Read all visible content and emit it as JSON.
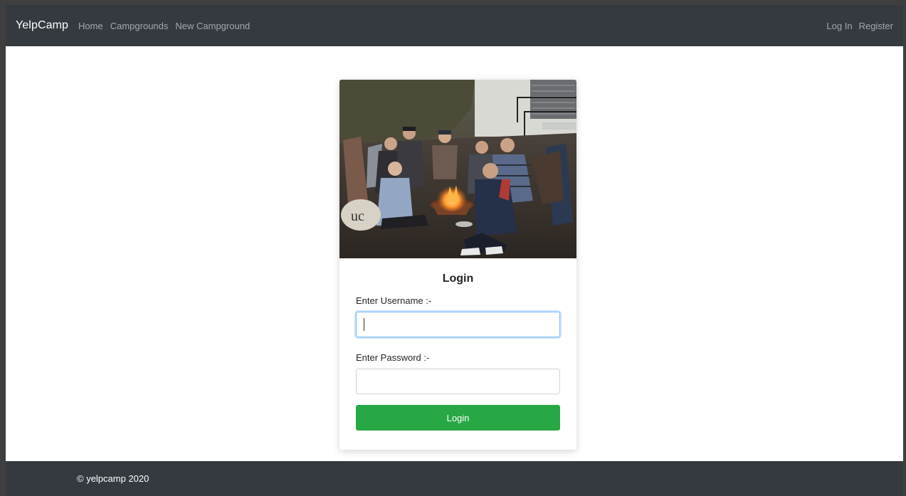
{
  "navbar": {
    "brand": "YelpCamp",
    "links": [
      "Home",
      "Campgrounds",
      "New Campground"
    ],
    "right_links": [
      "Log In",
      "Register"
    ]
  },
  "card": {
    "title": "Login",
    "username_label": "Enter Username :-",
    "password_label": "Enter Password :-",
    "username_value": "",
    "password_value": "",
    "submit_label": "Login"
  },
  "footer": {
    "text": "© yelpcamp 2020"
  },
  "colors": {
    "navbar_bg": "#343a40",
    "button_bg": "#28a745"
  }
}
